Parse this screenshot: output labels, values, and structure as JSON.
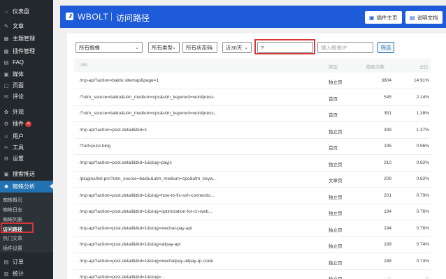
{
  "sidebar": {
    "items": [
      {
        "icon": "⌂",
        "icon_name": "dashboard-icon",
        "label": "仪表盘"
      },
      {
        "icon": "✎",
        "icon_name": "pin-icon",
        "label": "文章"
      },
      {
        "icon": "▦",
        "icon_name": "theme-icon",
        "label": "主题管理"
      },
      {
        "icon": "▦",
        "icon_name": "plugin-manage-icon",
        "label": "插件管理"
      },
      {
        "icon": "▤",
        "icon_name": "faq-icon",
        "label": "FAQ"
      },
      {
        "icon": "▣",
        "icon_name": "media-icon",
        "label": "媒体"
      },
      {
        "icon": "▢",
        "icon_name": "page-icon",
        "label": "页面"
      },
      {
        "icon": "✉",
        "icon_name": "comment-icon",
        "label": "评论"
      },
      {
        "icon": "✿",
        "icon_name": "appearance-icon",
        "label": "外观"
      },
      {
        "icon": "⚙",
        "icon_name": "plugins-icon",
        "label": "插件",
        "badge": "4"
      },
      {
        "icon": "☺",
        "icon_name": "users-icon",
        "label": "用户"
      },
      {
        "icon": "✂",
        "icon_name": "tools-icon",
        "label": "工具"
      },
      {
        "icon": "⚙",
        "icon_name": "settings-icon",
        "label": "设置"
      },
      {
        "icon": "▣",
        "icon_name": "search-push-icon",
        "label": "搜索推送"
      },
      {
        "icon": "✺",
        "icon_name": "spider-analysis-icon",
        "label": "蜘蛛分析",
        "active": true
      },
      {
        "icon": "▤",
        "icon_name": "orders-icon",
        "label": "订单"
      },
      {
        "icon": "▥",
        "icon_name": "stats-icon",
        "label": "统计"
      }
    ],
    "submenu": [
      {
        "label": "蜘蛛概况"
      },
      {
        "label": "蜘蛛日志"
      },
      {
        "label": "蜘蛛列表"
      },
      {
        "label": "访问路径",
        "current": true
      },
      {
        "label": "热门文章"
      },
      {
        "label": "插件设置"
      }
    ]
  },
  "header": {
    "brand": "WBOLT",
    "title": "访问路径",
    "btn_plugin_home": "插件主页",
    "btn_docs": "说明文档"
  },
  "filters": {
    "spider": "所有蜘蛛",
    "type": "所有类型",
    "status": "所有状态码",
    "range": "近30天",
    "url_value": "?",
    "ip_placeholder": "输入蜘蛛IP",
    "submit": "筛选"
  },
  "table": {
    "headers": {
      "url": "URL",
      "type": "类型",
      "visits": "爬取次数",
      "pct": "占比"
    },
    "rows": [
      {
        "url": "/mp-api?action=baidu.sitemap&page=1",
        "type": "独立页",
        "visits": "3804",
        "pct": "14.91%"
      },
      {
        "url": "/?utm_source=baidu&utm_medium=cpc&utm_keyword=wordpress",
        "type": "首页",
        "visits": "545",
        "pct": "2.14%"
      },
      {
        "url": "/?utm_source=baidu&utm_medium=cpc&utm_keyword=wordpress...",
        "type": "首页",
        "visits": "351",
        "pct": "1.38%"
      },
      {
        "url": "/mp-api?action=post.detail&tkd=1",
        "type": "独立页",
        "visits": "349",
        "pct": "1.37%"
      },
      {
        "url": "/?ref=pure-blog",
        "type": "首页",
        "visits": "245",
        "pct": "0.96%"
      },
      {
        "url": "/mp-api?action=post.detail&tkd=1&slug=payjs",
        "type": "独立页",
        "visits": "210",
        "pct": "0.82%"
      },
      {
        "url": "/plugins/bsl-pro?utm_source=baidu&utm_medium=cpc&utm_keyw...",
        "type": "文章页",
        "visits": "209",
        "pct": "0.82%"
      },
      {
        "url": "/mp-api?action=post.detail&tkd=1&slug=how-to-fix-ssh-connectio...",
        "type": "独立页",
        "visits": "201",
        "pct": "0.79%"
      },
      {
        "url": "/mp-api?action=post.detail&tkd=1&slug=optimization-for-cn-web...",
        "type": "独立页",
        "visits": "194",
        "pct": "0.76%"
      },
      {
        "url": "/mp-api?action=post.detail&tkd=1&slug=wechat-pay-api",
        "type": "独立页",
        "visits": "194",
        "pct": "0.76%"
      },
      {
        "url": "/mp-api?action=post.detail&tkd=1&slug=alipay-api",
        "type": "独立页",
        "visits": "189",
        "pct": "0.74%"
      },
      {
        "url": "/mp-api?action=post.detail&tkd=1&slug=wechatpay-alipay-qr-code",
        "type": "独立页",
        "visits": "188",
        "pct": "0.74%"
      },
      {
        "url": "/mp-api?action=post.detail&tkd=1&slug=...",
        "type": "独立页",
        "visits": "...",
        "pct": "..."
      }
    ]
  },
  "colors": {
    "header_bg": "#1e5bd8",
    "sidebar_bg": "#23282d",
    "active_item": "#2271b1",
    "highlight_box": "#d63638"
  }
}
